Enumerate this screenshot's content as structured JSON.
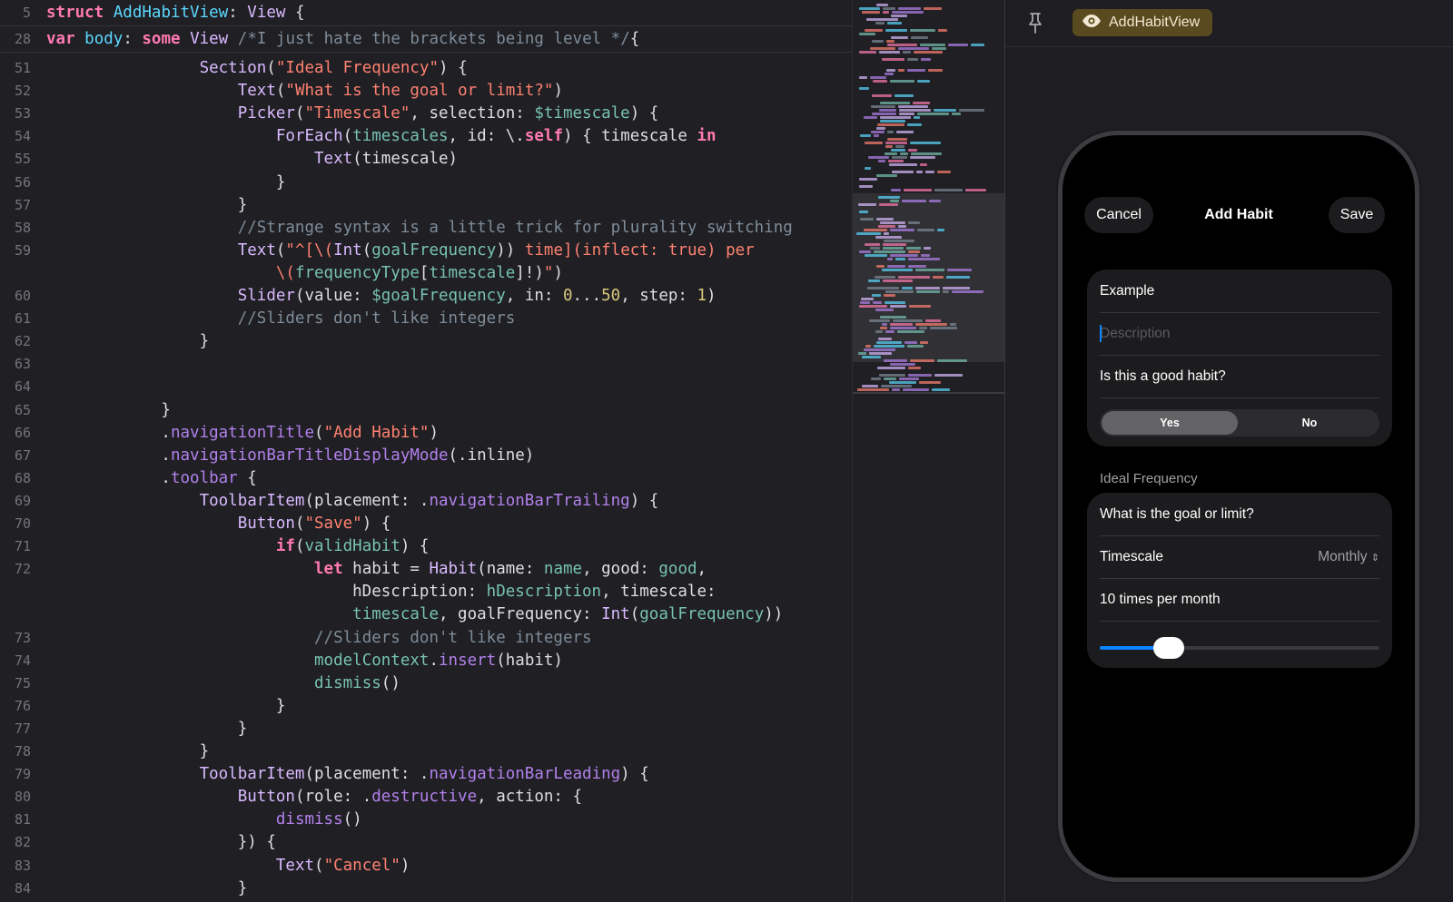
{
  "editor": {
    "sticky_lines": [
      {
        "n": "5",
        "segs": [
          [
            "kw",
            "struct "
          ],
          [
            "tdecl",
            "AddHabitView"
          ],
          [
            "pl",
            ": "
          ],
          [
            "ty",
            "View"
          ],
          [
            "pl",
            " {"
          ]
        ]
      },
      {
        "n": "28",
        "segs": [
          [
            "pl",
            "    "
          ],
          [
            "kw",
            "var "
          ],
          [
            "tdecl",
            "body"
          ],
          [
            "pl",
            ": "
          ],
          [
            "kw",
            "some "
          ],
          [
            "ty",
            "View"
          ],
          [
            "pl",
            " "
          ],
          [
            "cm",
            "/*I just hate the brackets being level */"
          ],
          [
            "pl",
            "{"
          ]
        ]
      }
    ],
    "lines": [
      {
        "n": "51",
        "segs": [
          [
            "pl",
            "                "
          ],
          [
            "ty",
            "Section"
          ],
          [
            "pl",
            "("
          ],
          [
            "st",
            "\"Ideal Frequency\""
          ],
          [
            "pl",
            ") {"
          ]
        ]
      },
      {
        "n": "52",
        "segs": [
          [
            "pl",
            "                    "
          ],
          [
            "ty",
            "Text"
          ],
          [
            "pl",
            "("
          ],
          [
            "st",
            "\"What is the goal or limit?\""
          ],
          [
            "pl",
            ")"
          ]
        ]
      },
      {
        "n": "53",
        "segs": [
          [
            "pl",
            "                    "
          ],
          [
            "ty",
            "Picker"
          ],
          [
            "pl",
            "("
          ],
          [
            "st",
            "\"Timescale\""
          ],
          [
            "pl",
            ", selection: "
          ],
          [
            "vr",
            "$timescale"
          ],
          [
            "pl",
            ") {"
          ]
        ]
      },
      {
        "n": "54",
        "segs": [
          [
            "pl",
            "                        "
          ],
          [
            "ty",
            "ForEach"
          ],
          [
            "pl",
            "("
          ],
          [
            "vr",
            "timescales"
          ],
          [
            "pl",
            ", id: \\."
          ],
          [
            "kw",
            "self"
          ],
          [
            "pl",
            ") { timescale "
          ],
          [
            "kw",
            "in"
          ]
        ]
      },
      {
        "n": "55",
        "segs": [
          [
            "pl",
            "                            "
          ],
          [
            "ty",
            "Text"
          ],
          [
            "pl",
            "(timescale)"
          ]
        ]
      },
      {
        "n": "56",
        "segs": [
          [
            "pl",
            "                        }"
          ]
        ]
      },
      {
        "n": "57",
        "segs": [
          [
            "pl",
            "                    }"
          ]
        ]
      },
      {
        "n": "58",
        "segs": [
          [
            "pl",
            "                    "
          ],
          [
            "cm",
            "//Strange syntax is a little trick for plurality switching"
          ]
        ]
      },
      {
        "n": "59",
        "segs": [
          [
            "pl",
            "                    "
          ],
          [
            "ty",
            "Text"
          ],
          [
            "pl",
            "("
          ],
          [
            "st",
            "\"^[\\("
          ],
          [
            "ty",
            "Int"
          ],
          [
            "pl",
            "("
          ],
          [
            "vr",
            "goalFrequency"
          ],
          [
            "pl",
            "))"
          ],
          [
            "st",
            " time](inflect: true) per"
          ]
        ]
      },
      {
        "n": "",
        "segs": [
          [
            "pl",
            "                        "
          ],
          [
            "st",
            "\\("
          ],
          [
            "vr",
            "frequencyType"
          ],
          [
            "pl",
            "["
          ],
          [
            "vr",
            "timescale"
          ],
          [
            "pl",
            "]!)"
          ],
          [
            "st",
            "\""
          ],
          [
            "pl",
            ")"
          ]
        ]
      },
      {
        "n": "60",
        "segs": [
          [
            "pl",
            "                    "
          ],
          [
            "ty",
            "Slider"
          ],
          [
            "pl",
            "(value: "
          ],
          [
            "vr",
            "$goalFrequency"
          ],
          [
            "pl",
            ", in: "
          ],
          [
            "nm",
            "0"
          ],
          [
            "pl",
            "..."
          ],
          [
            "nm",
            "50"
          ],
          [
            "pl",
            ", step: "
          ],
          [
            "nm",
            "1"
          ],
          [
            "pl",
            ")"
          ]
        ]
      },
      {
        "n": "61",
        "segs": [
          [
            "pl",
            "                    "
          ],
          [
            "cm",
            "//Sliders don't like integers"
          ]
        ]
      },
      {
        "n": "62",
        "segs": [
          [
            "pl",
            "                }"
          ]
        ]
      },
      {
        "n": "63",
        "segs": []
      },
      {
        "n": "64",
        "segs": []
      },
      {
        "n": "65",
        "segs": [
          [
            "pl",
            "            }"
          ]
        ]
      },
      {
        "n": "66",
        "segs": [
          [
            "pl",
            "            ."
          ],
          [
            "fn",
            "navigationTitle"
          ],
          [
            "pl",
            "("
          ],
          [
            "st",
            "\"Add Habit\""
          ],
          [
            "pl",
            ")"
          ]
        ]
      },
      {
        "n": "67",
        "segs": [
          [
            "pl",
            "            ."
          ],
          [
            "fn",
            "navigationBarTitleDisplayMode"
          ],
          [
            "pl",
            "(.inline)"
          ]
        ]
      },
      {
        "n": "68",
        "segs": [
          [
            "pl",
            "            ."
          ],
          [
            "fn",
            "toolbar"
          ],
          [
            "pl",
            " {"
          ]
        ]
      },
      {
        "n": "69",
        "segs": [
          [
            "pl",
            "                "
          ],
          [
            "ty",
            "ToolbarItem"
          ],
          [
            "pl",
            "(placement: ."
          ],
          [
            "fn",
            "navigationBarTrailing"
          ],
          [
            "pl",
            ") {"
          ]
        ]
      },
      {
        "n": "70",
        "segs": [
          [
            "pl",
            "                    "
          ],
          [
            "ty",
            "Button"
          ],
          [
            "pl",
            "("
          ],
          [
            "st",
            "\"Save\""
          ],
          [
            "pl",
            ") {"
          ]
        ]
      },
      {
        "n": "71",
        "segs": [
          [
            "pl",
            "                        "
          ],
          [
            "kw",
            "if"
          ],
          [
            "pl",
            "("
          ],
          [
            "vr",
            "validHabit"
          ],
          [
            "pl",
            ") {"
          ]
        ]
      },
      {
        "n": "72",
        "segs": [
          [
            "pl",
            "                            "
          ],
          [
            "kw",
            "let "
          ],
          [
            "pl",
            "habit = "
          ],
          [
            "ty",
            "Habit"
          ],
          [
            "pl",
            "(name: "
          ],
          [
            "vr",
            "name"
          ],
          [
            "pl",
            ", good: "
          ],
          [
            "vr",
            "good"
          ],
          [
            "pl",
            ","
          ]
        ]
      },
      {
        "n": "",
        "segs": [
          [
            "pl",
            "                                hDescription: "
          ],
          [
            "vr",
            "hDescription"
          ],
          [
            "pl",
            ", timescale:"
          ]
        ]
      },
      {
        "n": "",
        "segs": [
          [
            "pl",
            "                                "
          ],
          [
            "vr",
            "timescale"
          ],
          [
            "pl",
            ", goalFrequency: "
          ],
          [
            "ty",
            "Int"
          ],
          [
            "pl",
            "("
          ],
          [
            "vr",
            "goalFrequency"
          ],
          [
            "pl",
            "))"
          ]
        ]
      },
      {
        "n": "73",
        "segs": [
          [
            "pl",
            "                            "
          ],
          [
            "cm",
            "//Sliders don't like integers"
          ]
        ]
      },
      {
        "n": "74",
        "segs": [
          [
            "pl",
            "                            "
          ],
          [
            "vr",
            "modelContext"
          ],
          [
            "pl",
            "."
          ],
          [
            "fn",
            "insert"
          ],
          [
            "pl",
            "(habit)"
          ]
        ]
      },
      {
        "n": "75",
        "segs": [
          [
            "pl",
            "                            "
          ],
          [
            "vr",
            "dismiss"
          ],
          [
            "pl",
            "()"
          ]
        ]
      },
      {
        "n": "76",
        "segs": [
          [
            "pl",
            "                        }"
          ]
        ]
      },
      {
        "n": "77",
        "segs": [
          [
            "pl",
            "                    }"
          ]
        ]
      },
      {
        "n": "78",
        "segs": [
          [
            "pl",
            "                }"
          ]
        ]
      },
      {
        "n": "79",
        "segs": [
          [
            "pl",
            "                "
          ],
          [
            "ty",
            "ToolbarItem"
          ],
          [
            "pl",
            "(placement: ."
          ],
          [
            "fn",
            "navigationBarLeading"
          ],
          [
            "pl",
            ") {"
          ]
        ]
      },
      {
        "n": "80",
        "segs": [
          [
            "pl",
            "                    "
          ],
          [
            "ty",
            "Button"
          ],
          [
            "pl",
            "(role: ."
          ],
          [
            "fn",
            "destructive"
          ],
          [
            "pl",
            ", action: {"
          ]
        ]
      },
      {
        "n": "81",
        "segs": [
          [
            "pl",
            "                        "
          ],
          [
            "fn",
            "dismiss"
          ],
          [
            "pl",
            "()"
          ]
        ]
      },
      {
        "n": "82",
        "segs": [
          [
            "pl",
            "                    }) {"
          ]
        ]
      },
      {
        "n": "83",
        "segs": [
          [
            "pl",
            "                        "
          ],
          [
            "ty",
            "Text"
          ],
          [
            "pl",
            "("
          ],
          [
            "st",
            "\"Cancel\""
          ],
          [
            "pl",
            ")"
          ]
        ]
      },
      {
        "n": "84",
        "segs": [
          [
            "pl",
            "                    }"
          ]
        ]
      }
    ]
  },
  "preview": {
    "chip_label": "AddHabitView",
    "nav": {
      "cancel": "Cancel",
      "title": "Add Habit",
      "save": "Save"
    },
    "form": {
      "name_value": "Example",
      "description_placeholder": "Description",
      "good_question": "Is this a good habit?",
      "seg_yes": "Yes",
      "seg_no": "No",
      "section_header": "Ideal Frequency",
      "goal_question": "What is the goal or limit?",
      "timescale_label": "Timescale",
      "timescale_value": "Monthly",
      "frequency_text": "10 times per month",
      "slider_fraction": 0.2,
      "accent": "#0a84ff"
    }
  }
}
